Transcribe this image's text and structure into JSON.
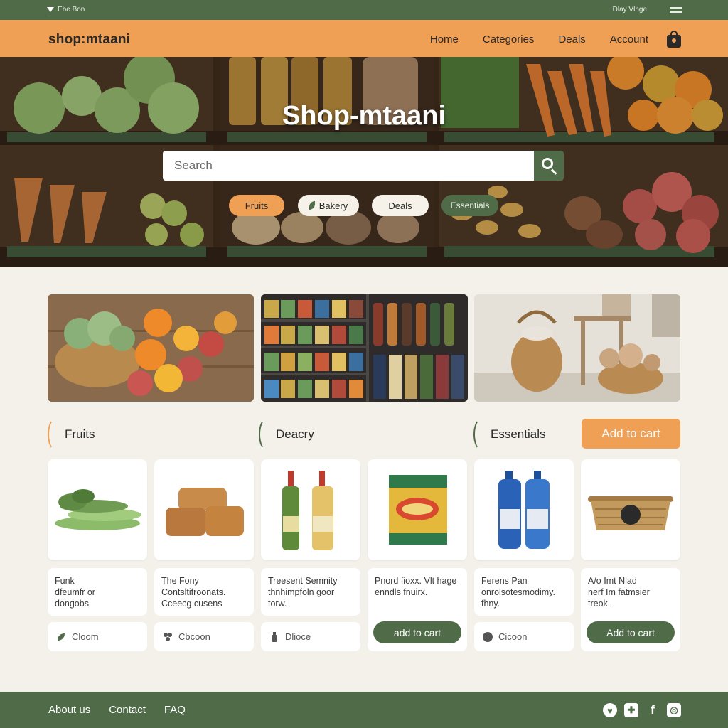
{
  "topstrip": {
    "left_text": "Ebe Bon",
    "right_text": "Dlay Vlnge"
  },
  "header": {
    "logo": "shop:mtaani",
    "nav": [
      "Home",
      "Categories",
      "Deals",
      "Account"
    ]
  },
  "hero": {
    "title": "Shop-mtaani",
    "search_placeholder": "Search",
    "chips": [
      "Fruits",
      "Bakery",
      "Deals",
      "Essentials"
    ]
  },
  "categories": {
    "labels": [
      "Fruits",
      "Deacry",
      "Essentials"
    ],
    "add_to_cart_label": "Add to cart"
  },
  "products": [
    {
      "desc": [
        "Funk",
        "dfeumfr or",
        "dongobs"
      ],
      "action": "Cloom",
      "icon": "leaf-icon"
    },
    {
      "desc": [
        "The Fony",
        "Contsltifroonats.",
        "Cceecg cusens"
      ],
      "action": "Cbcoon",
      "icon": "flower-icon"
    },
    {
      "desc": [
        "Treesent Semnity",
        "thnhimpfoln goor",
        "torw."
      ],
      "action": "Dlioce",
      "icon": "bottle-icon"
    },
    {
      "desc": [
        "Pnord fioxx. Vlt hage",
        "enndls fnuirx."
      ],
      "action": "add to cart",
      "icon": ""
    },
    {
      "desc": [
        "Ferens Pan",
        "onrolsotesmodimy.",
        "fhny."
      ],
      "action": "Cicoon",
      "icon": "circle-icon"
    },
    {
      "desc": [
        "A/o Imt Nlad",
        "nerf Im fatmsier",
        "treok."
      ],
      "action": "Add to cart",
      "icon": ""
    }
  ],
  "footer": {
    "links": [
      "About us",
      "Contact",
      "FAQ"
    ],
    "socials": [
      "heart-icon",
      "plus-icon",
      "facebook-icon",
      "instagram-icon"
    ]
  },
  "colors": {
    "green": "#4f6b48",
    "orange": "#f0a055",
    "cream": "#f4f1ea"
  }
}
